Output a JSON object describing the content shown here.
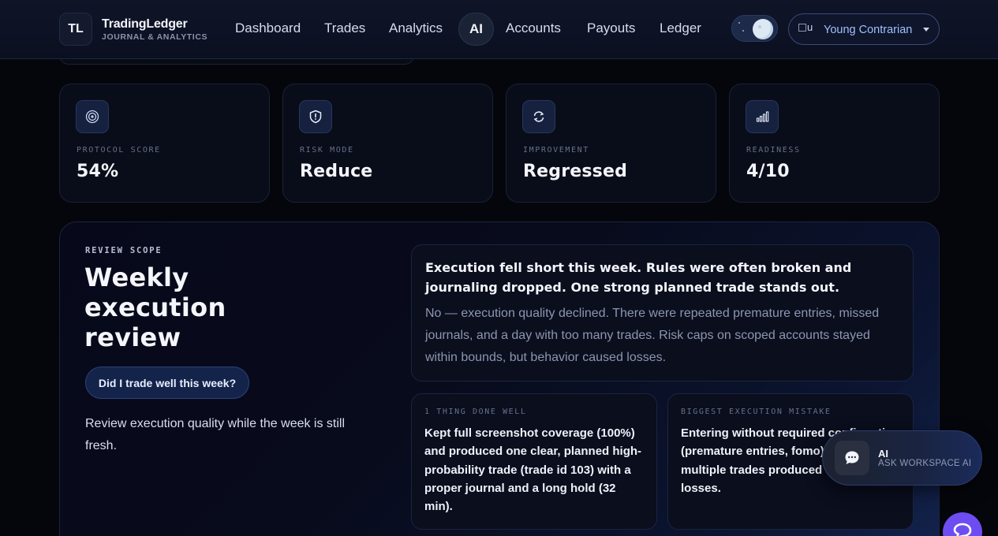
{
  "brand": {
    "initials": "TL",
    "name": "TradingLedger",
    "subtitle": "JOURNAL & ANALYTICS"
  },
  "nav": {
    "items": [
      {
        "label": "Dashboard"
      },
      {
        "label": "Trades"
      },
      {
        "label": "Analytics"
      },
      {
        "label": "AI",
        "active": true
      },
      {
        "label": "Accounts"
      },
      {
        "label": "Payouts"
      },
      {
        "label": "Ledger"
      }
    ]
  },
  "theme_toggle": {
    "mode": "dark",
    "icon": "moon-icon"
  },
  "user": {
    "avatar_alt": "u",
    "name": "Young Contrarian"
  },
  "stats": [
    {
      "label": "PROTOCOL SCORE",
      "value": "54%",
      "icon": "target-icon"
    },
    {
      "label": "RISK MODE",
      "value": "Reduce",
      "icon": "shield-alert-icon"
    },
    {
      "label": "IMPROVEMENT",
      "value": "Regressed",
      "icon": "refresh-icon"
    },
    {
      "label": "READINESS",
      "value": "4/10",
      "icon": "bar-chart-icon"
    }
  ],
  "review": {
    "eyebrow": "REVIEW SCOPE",
    "title": "Weekly execution review",
    "question": "Did I trade well this week?",
    "description": "Review execution quality while the week is still fresh.",
    "summary_headline": "Execution fell short this week. Rules were often broken and journaling dropped. One strong planned trade stands out.",
    "summary_body": "No — execution quality declined. There were repeated premature entries, missed journals, and a day with too many trades. Risk caps on scoped accounts stayed within bounds, but behavior caused losses.",
    "done_well": {
      "label": "1 THING DONE WELL",
      "text": "Kept full screenshot coverage (100%) and produced one clear, planned high-probability trade (trade id 103) with a proper journal and a long hold (32 min)."
    },
    "biggest_mistake": {
      "label": "BIGGEST EXECUTION MISTAKE",
      "text": "Entering without required confirmation (premature entries, fomo) across multiple trades produced the largest losses."
    }
  },
  "ai_fab": {
    "title": "AI",
    "subtitle": "ASK WORKSPACE AI",
    "icon": "chat-bubble-icon"
  },
  "colors": {
    "accent": "#6d4df2",
    "link": "#9ec0ff",
    "panel_border": "#1c2440"
  }
}
